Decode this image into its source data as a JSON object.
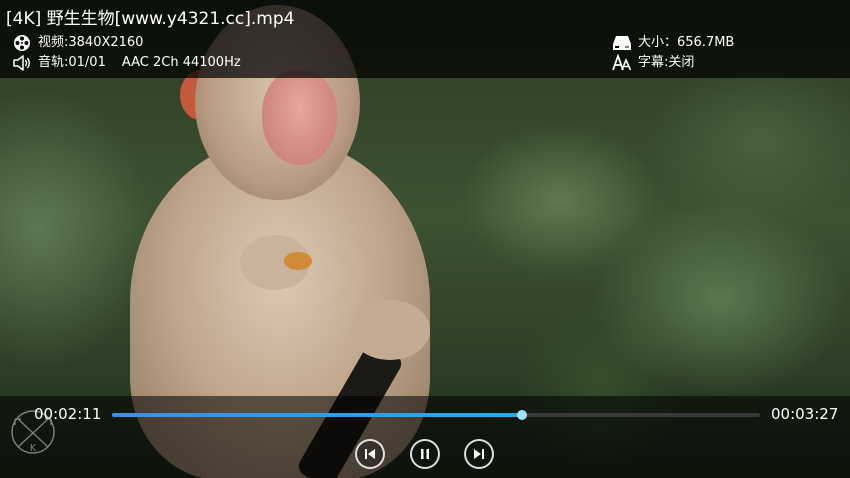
{
  "title": "[4K] 野生生物[www.y4321.cc].mp4",
  "info": {
    "video": "视频:3840X2160",
    "audio_track": "音轨:01/01",
    "audio_details": "AAC  2Ch  44100Hz",
    "size": "大小：656.7MB",
    "subtitle": "字幕:关闭"
  },
  "playback": {
    "current_time": "00:02:11",
    "total_time": "00:03:27",
    "progress_fraction": 0.633
  },
  "icons": {
    "video": "film-reel-icon",
    "audio": "speaker-icon",
    "size": "storage-drive-icon",
    "subtitle": "subtitle-aa-icon",
    "prev": "skip-previous-icon",
    "pause": "pause-icon",
    "next": "skip-next-icon",
    "logo": "k-player-logo-icon"
  },
  "colors": {
    "progress_start": "#3f8fe0",
    "progress_end": "#2aa8e8",
    "thumb": "#9fe4ff"
  }
}
